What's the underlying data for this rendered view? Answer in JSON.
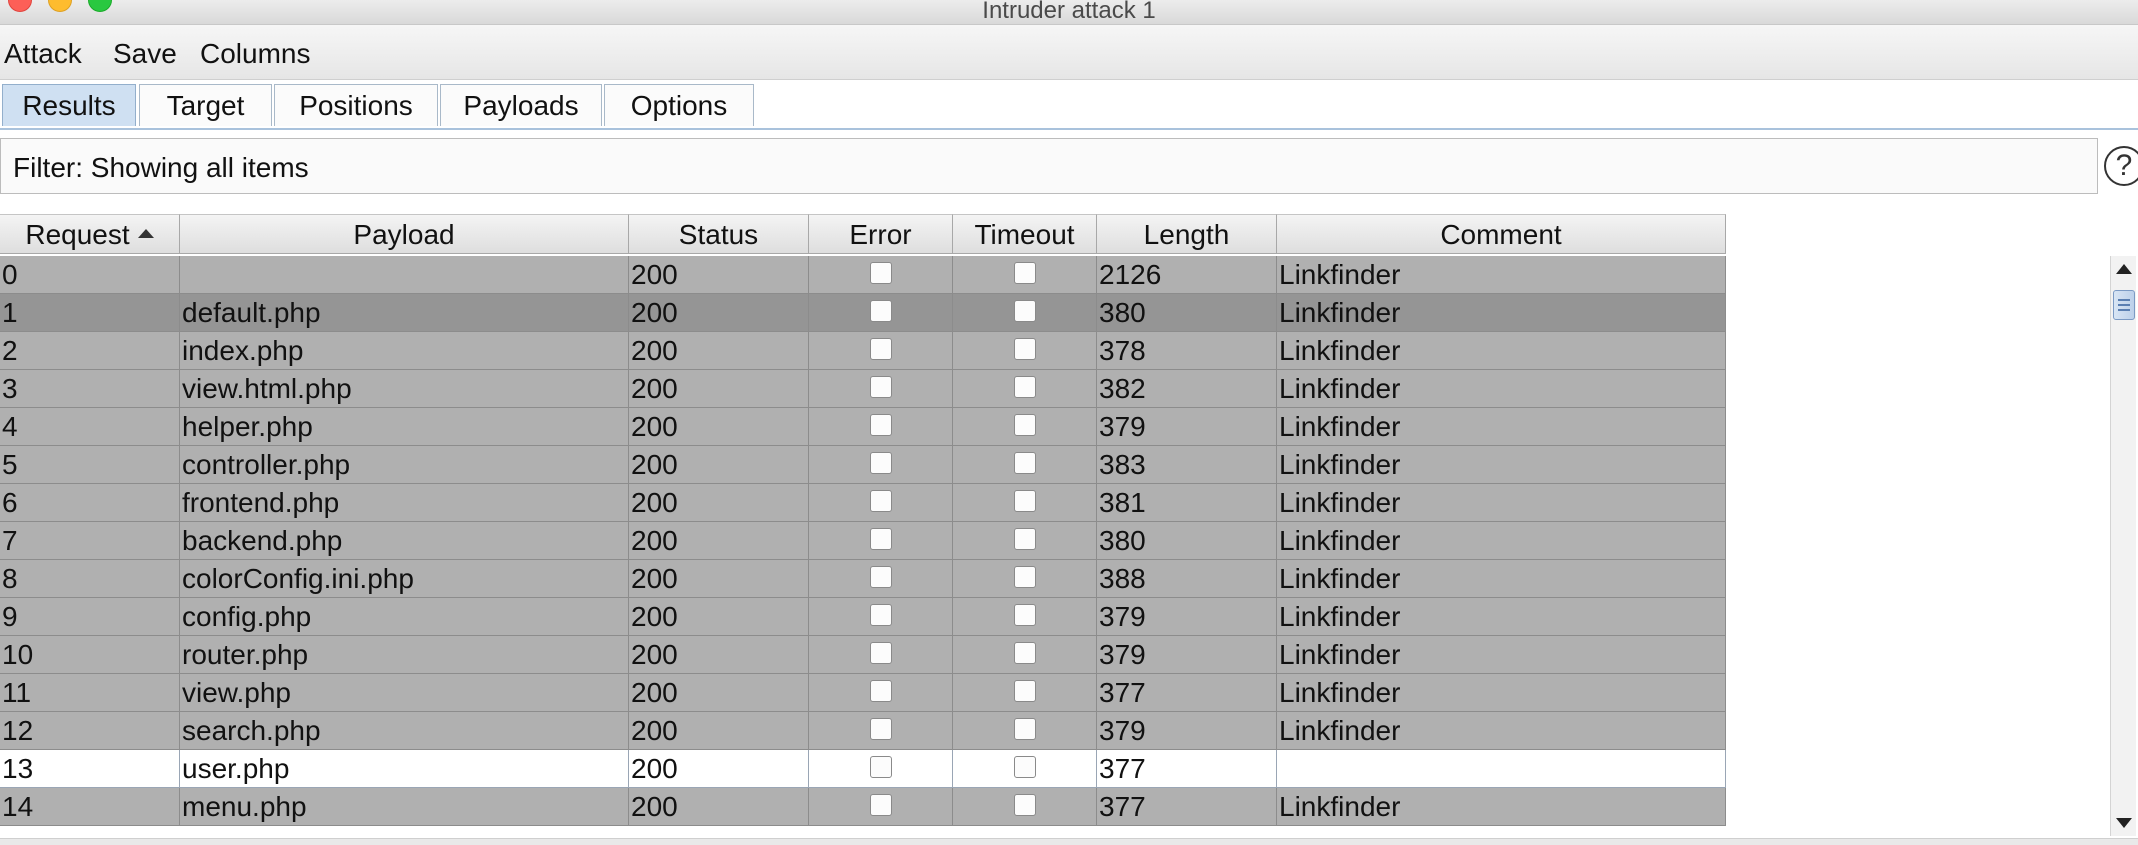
{
  "window": {
    "title": "Intruder attack 1"
  },
  "menu": [
    "Attack",
    "Save",
    "Columns"
  ],
  "tabs": [
    "Results",
    "Target",
    "Positions",
    "Payloads",
    "Options"
  ],
  "active_tab": "Results",
  "filter": {
    "text": "Filter: Showing all items",
    "help_label": "?"
  },
  "columns": [
    "Request",
    "Payload",
    "Status",
    "Error",
    "Timeout",
    "Length",
    "Comment"
  ],
  "sorted_column": "Request",
  "rows": [
    {
      "request": "0",
      "payload": "",
      "status": "200",
      "error": false,
      "timeout": false,
      "length": "2126",
      "comment": "Linkfinder",
      "style": "gray"
    },
    {
      "request": "1",
      "payload": "default.php",
      "status": "200",
      "error": false,
      "timeout": false,
      "length": "380",
      "comment": "Linkfinder",
      "style": "dark"
    },
    {
      "request": "2",
      "payload": "index.php",
      "status": "200",
      "error": false,
      "timeout": false,
      "length": "378",
      "comment": "Linkfinder",
      "style": "gray"
    },
    {
      "request": "3",
      "payload": "view.html.php",
      "status": "200",
      "error": false,
      "timeout": false,
      "length": "382",
      "comment": "Linkfinder",
      "style": "gray"
    },
    {
      "request": "4",
      "payload": "helper.php",
      "status": "200",
      "error": false,
      "timeout": false,
      "length": "379",
      "comment": "Linkfinder",
      "style": "gray"
    },
    {
      "request": "5",
      "payload": "controller.php",
      "status": "200",
      "error": false,
      "timeout": false,
      "length": "383",
      "comment": "Linkfinder",
      "style": "gray"
    },
    {
      "request": "6",
      "payload": "frontend.php",
      "status": "200",
      "error": false,
      "timeout": false,
      "length": "381",
      "comment": "Linkfinder",
      "style": "gray"
    },
    {
      "request": "7",
      "payload": "backend.php",
      "status": "200",
      "error": false,
      "timeout": false,
      "length": "380",
      "comment": "Linkfinder",
      "style": "gray"
    },
    {
      "request": "8",
      "payload": "colorConfig.ini.php",
      "status": "200",
      "error": false,
      "timeout": false,
      "length": "388",
      "comment": "Linkfinder",
      "style": "gray"
    },
    {
      "request": "9",
      "payload": "config.php",
      "status": "200",
      "error": false,
      "timeout": false,
      "length": "379",
      "comment": "Linkfinder",
      "style": "gray"
    },
    {
      "request": "10",
      "payload": "router.php",
      "status": "200",
      "error": false,
      "timeout": false,
      "length": "379",
      "comment": "Linkfinder",
      "style": "gray"
    },
    {
      "request": "11",
      "payload": "view.php",
      "status": "200",
      "error": false,
      "timeout": false,
      "length": "377",
      "comment": "Linkfinder",
      "style": "gray"
    },
    {
      "request": "12",
      "payload": "search.php",
      "status": "200",
      "error": false,
      "timeout": false,
      "length": "379",
      "comment": "Linkfinder",
      "style": "gray"
    },
    {
      "request": "13",
      "payload": "user.php",
      "status": "200",
      "error": false,
      "timeout": false,
      "length": "377",
      "comment": "",
      "style": "white"
    },
    {
      "request": "14",
      "payload": "menu.php",
      "status": "200",
      "error": false,
      "timeout": false,
      "length": "377",
      "comment": "Linkfinder",
      "style": "gray"
    }
  ],
  "colors": {
    "row_gray": "#b0b0b0",
    "row_selected": "#959595",
    "row_white": "#ffffff",
    "active_tab": "#cfe0f2"
  },
  "icons": {
    "sort": "sort-ascending-icon",
    "help": "help-icon",
    "scroll_up": "scroll-up-arrow-icon",
    "scroll_down": "scroll-down-arrow-icon"
  }
}
